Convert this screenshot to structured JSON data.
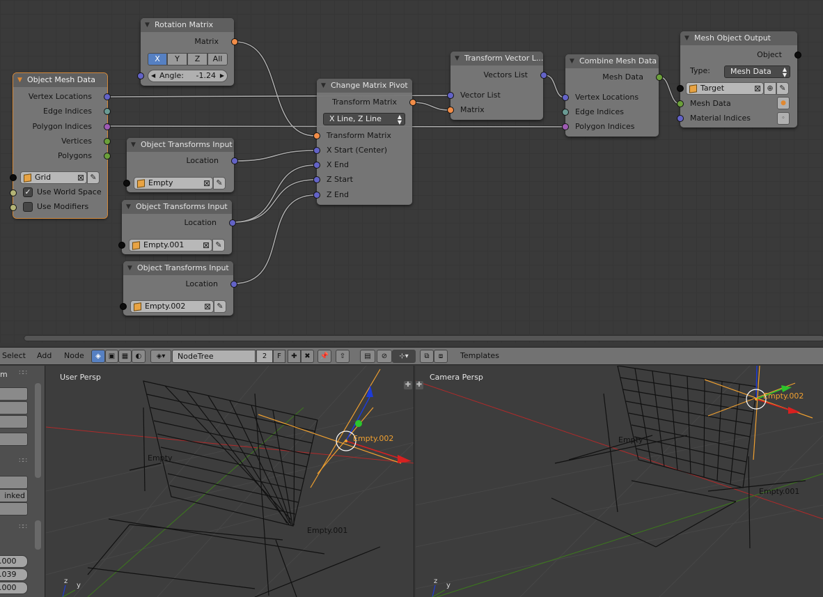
{
  "node_editor": {
    "nodes": {
      "rotation_matrix": {
        "title": "Rotation Matrix",
        "output_matrix": "Matrix",
        "axis_buttons": [
          "X",
          "Y",
          "Z",
          "All"
        ],
        "angle_label": "Angle:",
        "angle_value": "-1.24"
      },
      "object_mesh_data": {
        "title": "Object Mesh Data",
        "outputs": [
          "Vertex Locations",
          "Edge Indices",
          "Polygon Indices",
          "Vertices",
          "Polygons"
        ],
        "object_value": "Grid",
        "use_world_space": "Use World Space",
        "use_world_space_checked": true,
        "use_modifiers": "Use Modifiers",
        "use_modifiers_checked": false
      },
      "transforms_input_1": {
        "title": "Object Transforms Input",
        "output": "Location",
        "object_value": "Empty"
      },
      "transforms_input_2": {
        "title": "Object Transforms Input",
        "output": "Location",
        "object_value": "Empty.001"
      },
      "transforms_input_3": {
        "title": "Object Transforms Input",
        "output": "Location",
        "object_value": "Empty.002"
      },
      "change_matrix_pivot": {
        "title": "Change Matrix Pivot",
        "output": "Transform Matrix",
        "mode_value": "X Line, Z Line",
        "inputs": [
          "Transform Matrix",
          "X Start (Center)",
          "X End",
          "Z Start",
          "Z End"
        ]
      },
      "transform_vector_list": {
        "title": "Transform Vector L...",
        "output": "Vectors List",
        "inputs": [
          "Vector List",
          "Matrix"
        ]
      },
      "combine_mesh_data": {
        "title": "Combine Mesh Data",
        "output": "Mesh Data",
        "inputs": [
          "Vertex Locations",
          "Edge Indices",
          "Polygon Indices"
        ]
      },
      "mesh_object_output": {
        "title": "Mesh Object Output",
        "output": "Object",
        "type_label": "Type:",
        "type_value": "Mesh Data",
        "object_value": "Target",
        "inputs": [
          "Mesh Data",
          "Material Indices"
        ]
      }
    }
  },
  "header": {
    "menus": [
      "Select",
      "Add",
      "Node"
    ],
    "nodetree_value": "NodeTree",
    "user_count": "2",
    "fake_user": "F",
    "templates": "Templates"
  },
  "tool_panel": {
    "section_label": "m",
    "button_label": "inked",
    "values": [
      ".000",
      ".039",
      ".000"
    ]
  },
  "viewport_left": {
    "title": "User Persp",
    "labels": {
      "empty": "Empty",
      "empty001": "Empty.001",
      "empty002": "Empty.002"
    },
    "axis_z": "z",
    "axis_y": "y"
  },
  "viewport_right": {
    "title": "Camera Persp",
    "labels": {
      "empty": "Empty",
      "empty001": "Empty.001",
      "empty002": "Empty.002"
    },
    "axis_z": "z",
    "axis_y": "y"
  },
  "colors": {
    "vector_socket": "#6363c7",
    "matrix_socket": "#f28d48",
    "active_node_outline": "#d68a3a",
    "selection_blue": "#5680c2",
    "empty_orange": "#f0a030"
  }
}
